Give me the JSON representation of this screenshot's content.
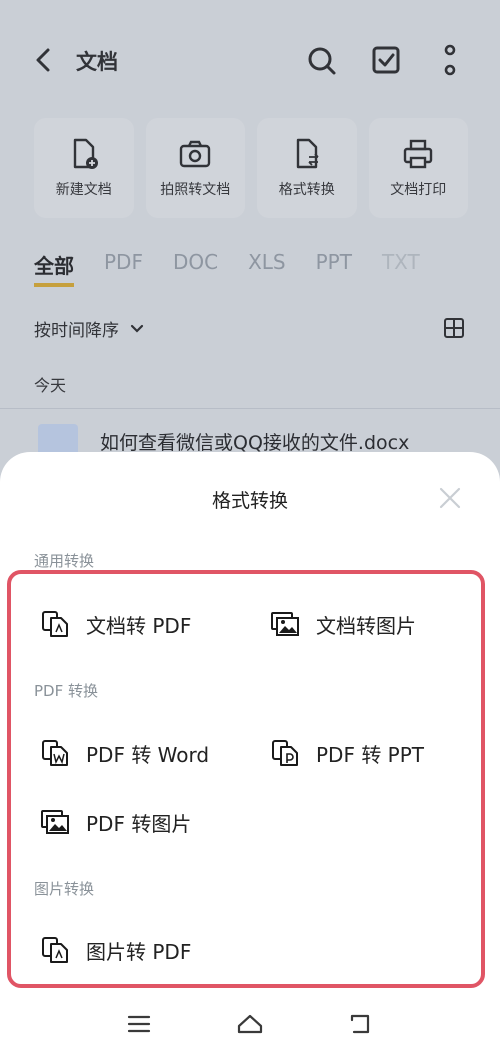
{
  "header": {
    "title": "文档"
  },
  "tools": [
    {
      "label": "新建文档",
      "icon": "new-doc-icon"
    },
    {
      "label": "拍照转文档",
      "icon": "camera-icon"
    },
    {
      "label": "格式转换",
      "icon": "convert-icon"
    },
    {
      "label": "文档打印",
      "icon": "printer-icon"
    }
  ],
  "tabs": [
    "全部",
    "PDF",
    "DOC",
    "XLS",
    "PPT",
    "TXT"
  ],
  "sort": {
    "label": "按时间降序"
  },
  "section": {
    "today": "今天"
  },
  "file": {
    "name": "如何查看微信或QQ接收的文件.docx"
  },
  "sheet": {
    "title": "格式转换",
    "sections": [
      "通用转换",
      "PDF 转换",
      "图片转换"
    ],
    "options": {
      "doc_to_pdf": "文档转 PDF",
      "doc_to_image": "文档转图片",
      "pdf_to_word": "PDF 转 Word",
      "pdf_to_ppt": "PDF 转 PPT",
      "pdf_to_image": "PDF 转图片",
      "image_to_pdf": "图片转 PDF"
    }
  },
  "colors": {
    "accent": "#e8b020",
    "highlight": "#e05565"
  }
}
